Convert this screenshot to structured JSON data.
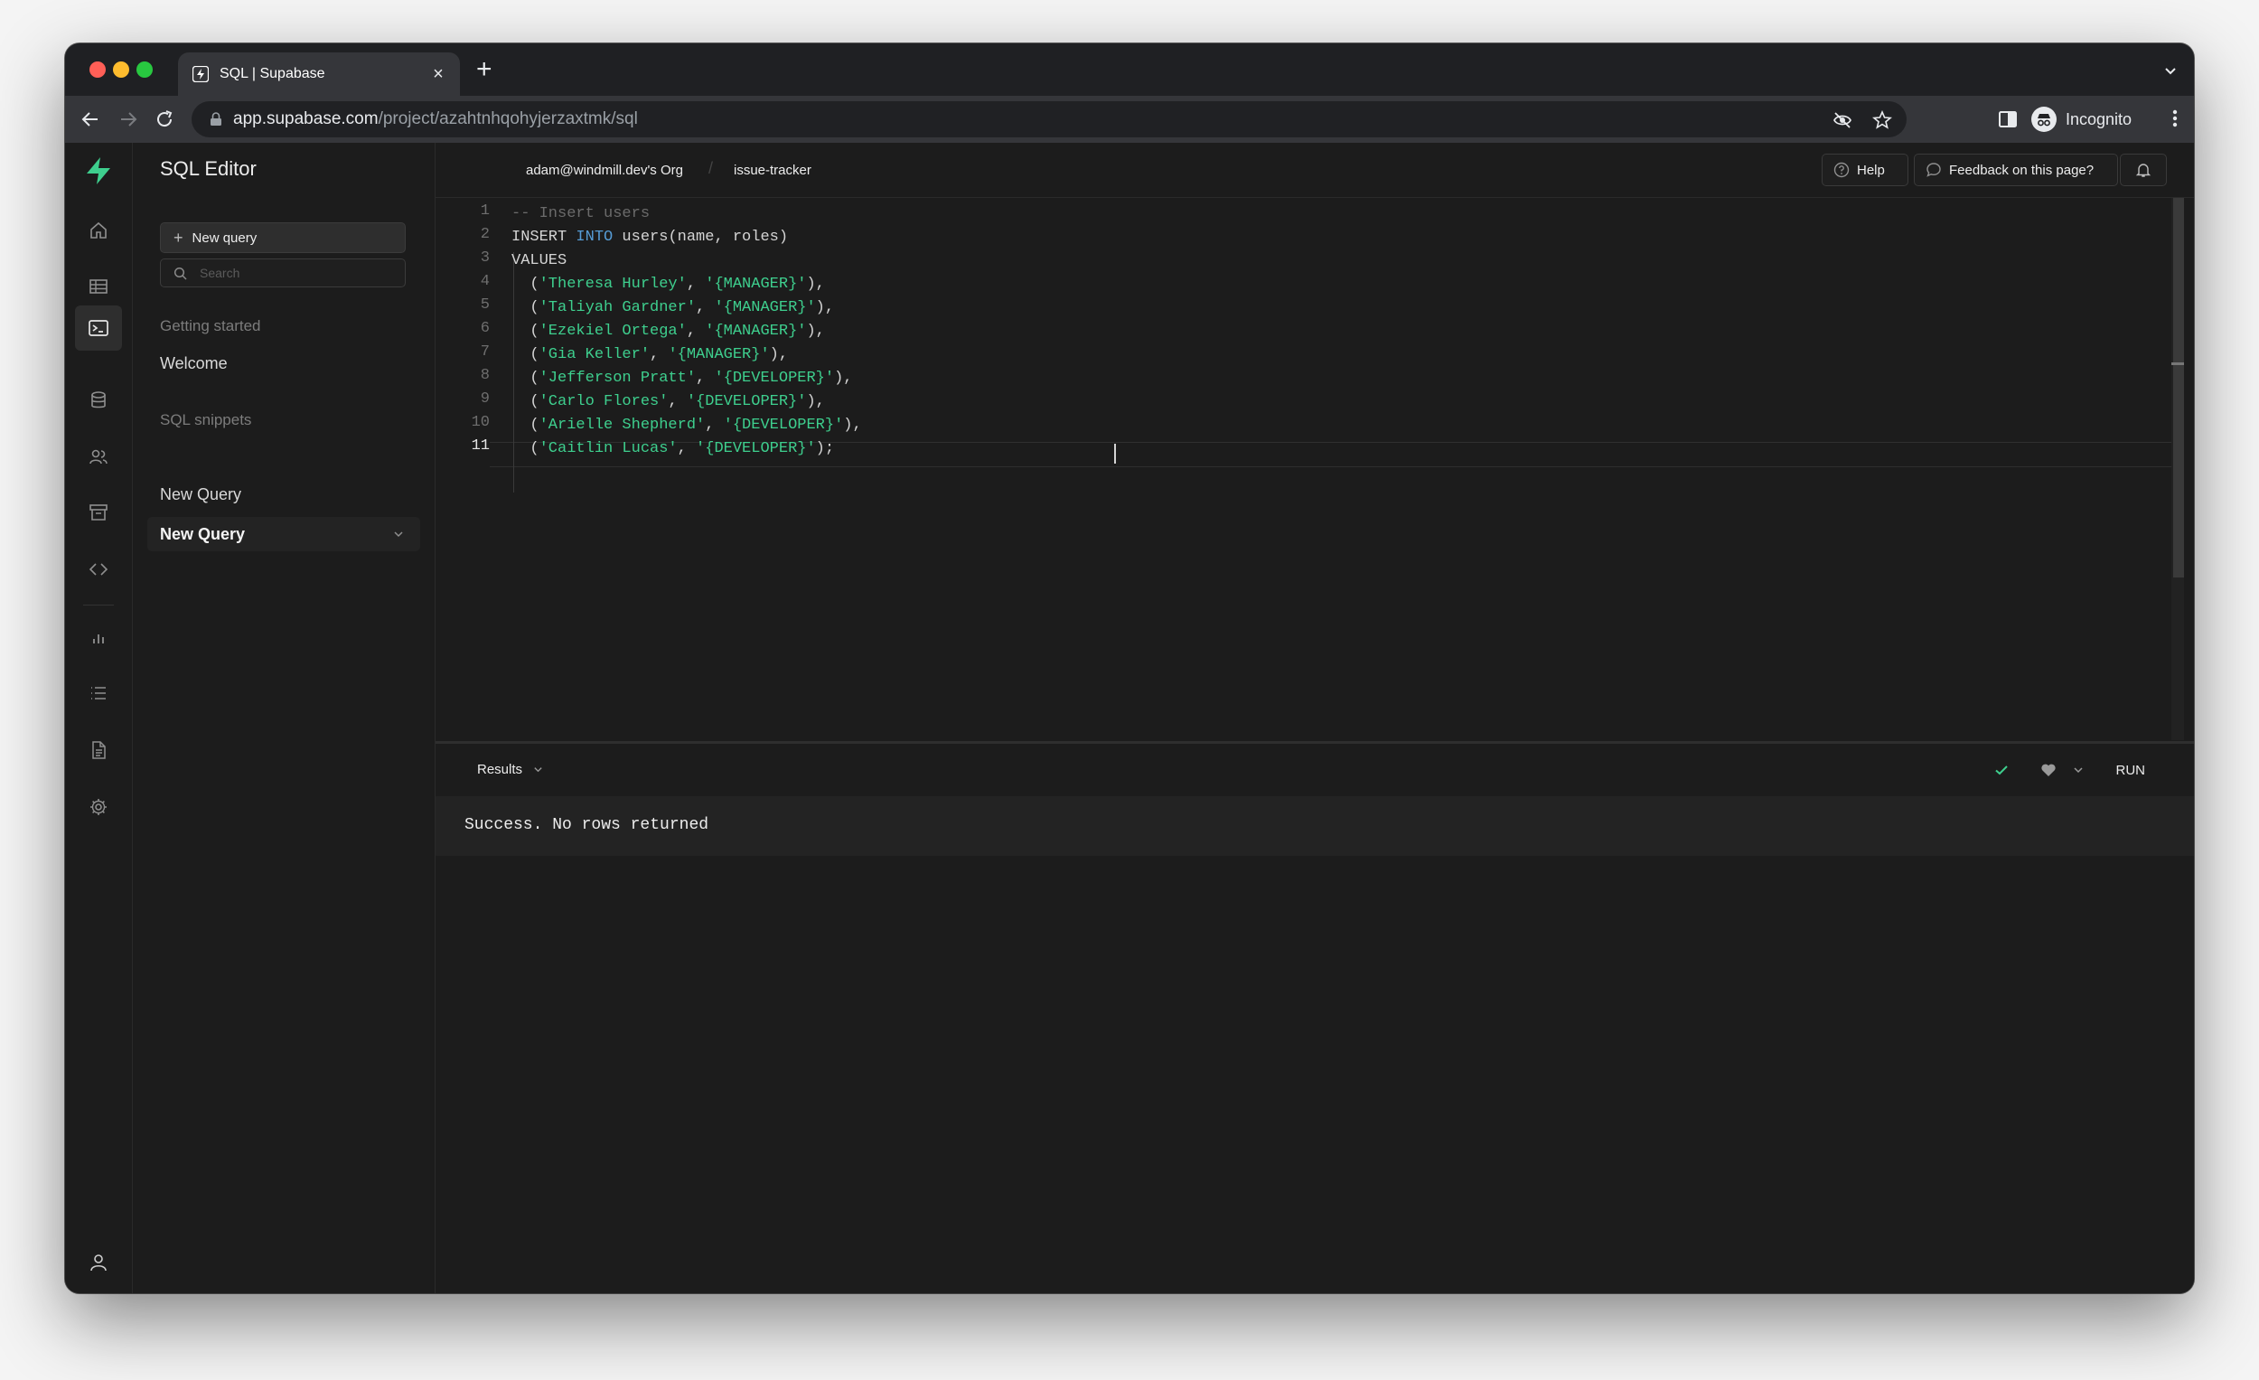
{
  "browser": {
    "tab_title": "SQL | Supabase",
    "url_host": "app.supabase.com",
    "url_path": "/project/azahtnhqohyjerzaxtmk/sql",
    "profile_label": "Incognito"
  },
  "sidebar": {
    "title": "SQL Editor",
    "new_query_label": "New query",
    "search_placeholder": "Search",
    "section_getting_started": "Getting started",
    "welcome_item": "Welcome",
    "section_snippets": "SQL snippets",
    "snippets": [
      "New Query",
      "New Query"
    ]
  },
  "topbar": {
    "org": "adam@windmill.dev's Org",
    "project": "issue-tracker",
    "help_label": "Help",
    "feedback_label": "Feedback on this page?"
  },
  "editor": {
    "line_numbers": [
      "1",
      "2",
      "3",
      "4",
      "5",
      "6",
      "7",
      "8",
      "9",
      "10",
      "11"
    ],
    "current_line": "11",
    "comment": "-- Insert users",
    "line2_kw": "INSERT",
    "line2_into": "INTO",
    "line2_rest": " users(name, roles)",
    "line3": "VALUES",
    "rows": [
      {
        "name": "'Theresa Hurley'",
        "role": "'{MANAGER}'",
        "end": "),"
      },
      {
        "name": "'Taliyah Gardner'",
        "role": "'{MANAGER}'",
        "end": "),"
      },
      {
        "name": "'Ezekiel Ortega'",
        "role": "'{MANAGER}'",
        "end": "),"
      },
      {
        "name": "'Gia Keller'",
        "role": "'{MANAGER}'",
        "end": "),"
      },
      {
        "name": "'Jefferson Pratt'",
        "role": "'{DEVELOPER}'",
        "end": "),"
      },
      {
        "name": "'Carlo Flores'",
        "role": "'{DEVELOPER}'",
        "end": "),"
      },
      {
        "name": "'Arielle Shepherd'",
        "role": "'{DEVELOPER}'",
        "end": "),"
      },
      {
        "name": "'Caitlin Lucas'",
        "role": "'{DEVELOPER}'",
        "end": ");"
      }
    ]
  },
  "results": {
    "label": "Results",
    "run_label": "RUN",
    "message": "Success. No rows returned"
  },
  "colors": {
    "brand": "#3ecf8e",
    "background": "#1c1c1c",
    "keyword": "#569cd6"
  }
}
